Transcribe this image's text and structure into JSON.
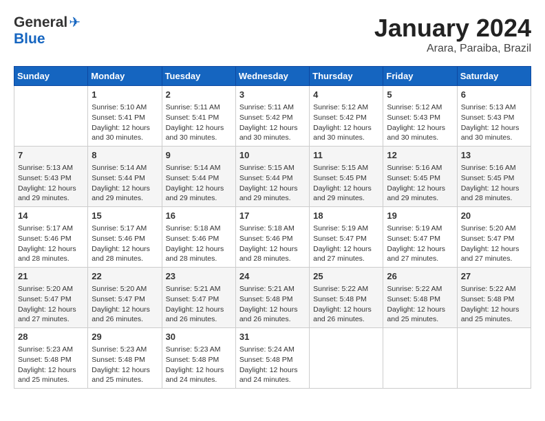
{
  "logo": {
    "general": "General",
    "blue": "Blue"
  },
  "title": "January 2024",
  "subtitle": "Arara, Paraiba, Brazil",
  "days_of_week": [
    "Sunday",
    "Monday",
    "Tuesday",
    "Wednesday",
    "Thursday",
    "Friday",
    "Saturday"
  ],
  "weeks": [
    [
      {
        "day": "",
        "info": ""
      },
      {
        "day": "1",
        "info": "Sunrise: 5:10 AM\nSunset: 5:41 PM\nDaylight: 12 hours\nand 30 minutes."
      },
      {
        "day": "2",
        "info": "Sunrise: 5:11 AM\nSunset: 5:41 PM\nDaylight: 12 hours\nand 30 minutes."
      },
      {
        "day": "3",
        "info": "Sunrise: 5:11 AM\nSunset: 5:42 PM\nDaylight: 12 hours\nand 30 minutes."
      },
      {
        "day": "4",
        "info": "Sunrise: 5:12 AM\nSunset: 5:42 PM\nDaylight: 12 hours\nand 30 minutes."
      },
      {
        "day": "5",
        "info": "Sunrise: 5:12 AM\nSunset: 5:43 PM\nDaylight: 12 hours\nand 30 minutes."
      },
      {
        "day": "6",
        "info": "Sunrise: 5:13 AM\nSunset: 5:43 PM\nDaylight: 12 hours\nand 30 minutes."
      }
    ],
    [
      {
        "day": "7",
        "info": "Sunrise: 5:13 AM\nSunset: 5:43 PM\nDaylight: 12 hours\nand 29 minutes."
      },
      {
        "day": "8",
        "info": "Sunrise: 5:14 AM\nSunset: 5:44 PM\nDaylight: 12 hours\nand 29 minutes."
      },
      {
        "day": "9",
        "info": "Sunrise: 5:14 AM\nSunset: 5:44 PM\nDaylight: 12 hours\nand 29 minutes."
      },
      {
        "day": "10",
        "info": "Sunrise: 5:15 AM\nSunset: 5:44 PM\nDaylight: 12 hours\nand 29 minutes."
      },
      {
        "day": "11",
        "info": "Sunrise: 5:15 AM\nSunset: 5:45 PM\nDaylight: 12 hours\nand 29 minutes."
      },
      {
        "day": "12",
        "info": "Sunrise: 5:16 AM\nSunset: 5:45 PM\nDaylight: 12 hours\nand 29 minutes."
      },
      {
        "day": "13",
        "info": "Sunrise: 5:16 AM\nSunset: 5:45 PM\nDaylight: 12 hours\nand 28 minutes."
      }
    ],
    [
      {
        "day": "14",
        "info": "Sunrise: 5:17 AM\nSunset: 5:46 PM\nDaylight: 12 hours\nand 28 minutes."
      },
      {
        "day": "15",
        "info": "Sunrise: 5:17 AM\nSunset: 5:46 PM\nDaylight: 12 hours\nand 28 minutes."
      },
      {
        "day": "16",
        "info": "Sunrise: 5:18 AM\nSunset: 5:46 PM\nDaylight: 12 hours\nand 28 minutes."
      },
      {
        "day": "17",
        "info": "Sunrise: 5:18 AM\nSunset: 5:46 PM\nDaylight: 12 hours\nand 28 minutes."
      },
      {
        "day": "18",
        "info": "Sunrise: 5:19 AM\nSunset: 5:47 PM\nDaylight: 12 hours\nand 27 minutes."
      },
      {
        "day": "19",
        "info": "Sunrise: 5:19 AM\nSunset: 5:47 PM\nDaylight: 12 hours\nand 27 minutes."
      },
      {
        "day": "20",
        "info": "Sunrise: 5:20 AM\nSunset: 5:47 PM\nDaylight: 12 hours\nand 27 minutes."
      }
    ],
    [
      {
        "day": "21",
        "info": "Sunrise: 5:20 AM\nSunset: 5:47 PM\nDaylight: 12 hours\nand 27 minutes."
      },
      {
        "day": "22",
        "info": "Sunrise: 5:20 AM\nSunset: 5:47 PM\nDaylight: 12 hours\nand 26 minutes."
      },
      {
        "day": "23",
        "info": "Sunrise: 5:21 AM\nSunset: 5:47 PM\nDaylight: 12 hours\nand 26 minutes."
      },
      {
        "day": "24",
        "info": "Sunrise: 5:21 AM\nSunset: 5:48 PM\nDaylight: 12 hours\nand 26 minutes."
      },
      {
        "day": "25",
        "info": "Sunrise: 5:22 AM\nSunset: 5:48 PM\nDaylight: 12 hours\nand 26 minutes."
      },
      {
        "day": "26",
        "info": "Sunrise: 5:22 AM\nSunset: 5:48 PM\nDaylight: 12 hours\nand 25 minutes."
      },
      {
        "day": "27",
        "info": "Sunrise: 5:22 AM\nSunset: 5:48 PM\nDaylight: 12 hours\nand 25 minutes."
      }
    ],
    [
      {
        "day": "28",
        "info": "Sunrise: 5:23 AM\nSunset: 5:48 PM\nDaylight: 12 hours\nand 25 minutes."
      },
      {
        "day": "29",
        "info": "Sunrise: 5:23 AM\nSunset: 5:48 PM\nDaylight: 12 hours\nand 25 minutes."
      },
      {
        "day": "30",
        "info": "Sunrise: 5:23 AM\nSunset: 5:48 PM\nDaylight: 12 hours\nand 24 minutes."
      },
      {
        "day": "31",
        "info": "Sunrise: 5:24 AM\nSunset: 5:48 PM\nDaylight: 12 hours\nand 24 minutes."
      },
      {
        "day": "",
        "info": ""
      },
      {
        "day": "",
        "info": ""
      },
      {
        "day": "",
        "info": ""
      }
    ]
  ]
}
